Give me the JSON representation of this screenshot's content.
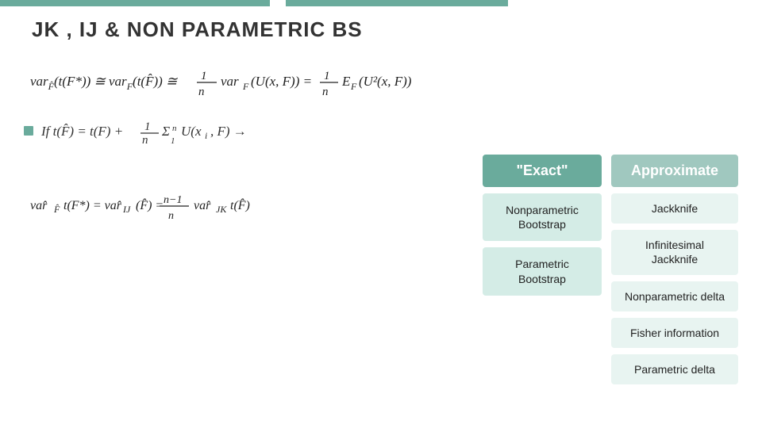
{
  "page": {
    "title": "JK , IJ & NON PARAMETRIC BS",
    "accent_color": "#6aab9c",
    "accent_color2": "#a0c8bf"
  },
  "top_bar": {
    "segment1_width": 340,
    "segment2_width": 280,
    "gap_width": 20
  },
  "exact_column": {
    "header": "\"Exact\"",
    "items": [
      {
        "label": "Nonparametric\nBootstrap"
      },
      {
        "label": "Parametric\nBootstrap"
      }
    ]
  },
  "approx_column": {
    "header": "Approximate",
    "items": [
      {
        "label": "Jackknife"
      },
      {
        "label": "Infinitesimal\nJackknife"
      },
      {
        "label": "Nonparametric delta"
      },
      {
        "label": "Fisher information"
      },
      {
        "label": "Parametric delta"
      }
    ]
  },
  "bullet": {
    "prefix": "If"
  }
}
